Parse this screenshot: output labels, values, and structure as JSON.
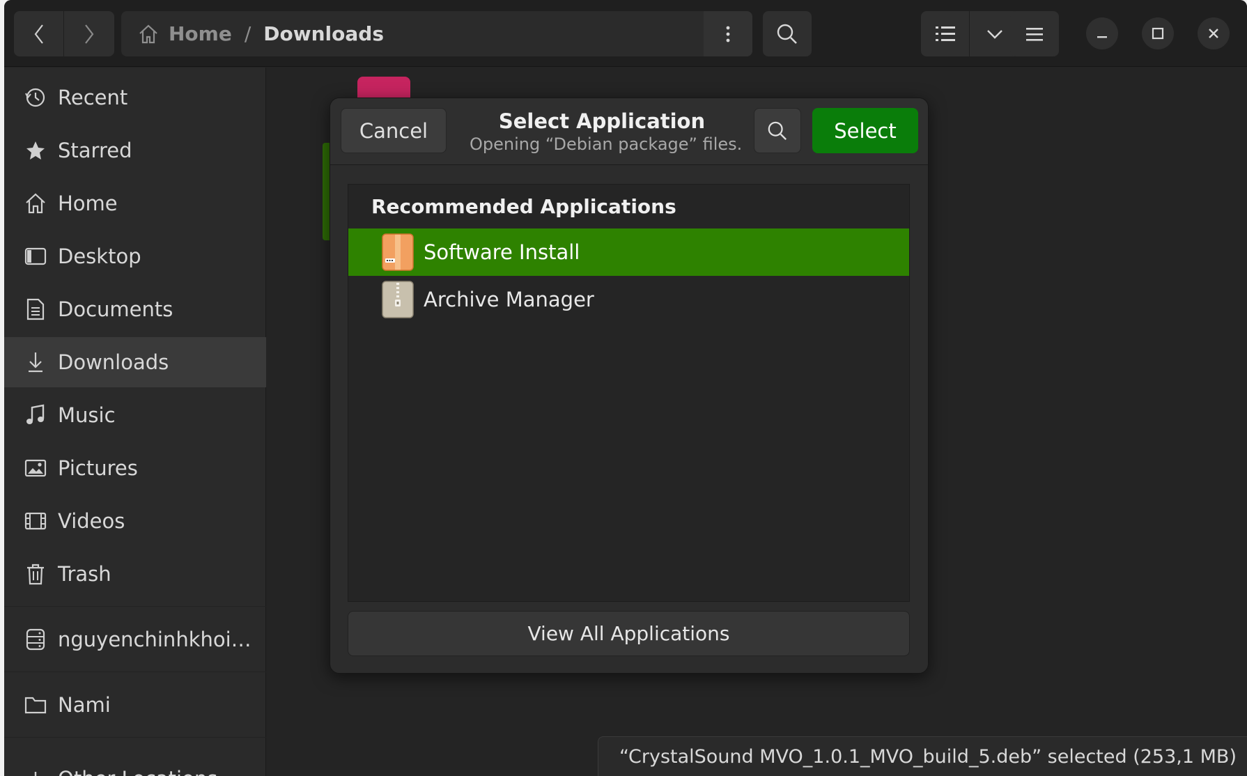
{
  "header": {
    "path": {
      "home": "Home",
      "separator": "/",
      "current": "Downloads"
    }
  },
  "sidebar": {
    "items": [
      {
        "label": "Recent",
        "icon": "clock-icon"
      },
      {
        "label": "Starred",
        "icon": "star-icon"
      },
      {
        "label": "Home",
        "icon": "home-icon"
      },
      {
        "label": "Desktop",
        "icon": "desktop-icon"
      },
      {
        "label": "Documents",
        "icon": "document-icon"
      },
      {
        "label": "Downloads",
        "icon": "download-icon",
        "active": true
      },
      {
        "label": "Music",
        "icon": "music-icon"
      },
      {
        "label": "Pictures",
        "icon": "picture-icon"
      },
      {
        "label": "Videos",
        "icon": "video-icon"
      },
      {
        "label": "Trash",
        "icon": "trash-icon"
      },
      {
        "label": "nguyenchinhkhoi…",
        "icon": "drive-icon"
      },
      {
        "label": "Nami",
        "icon": "folder-icon"
      },
      {
        "label": "Other Locations",
        "icon": "plus-icon"
      }
    ]
  },
  "dialog": {
    "cancel_label": "Cancel",
    "title": "Select Application",
    "subtitle": "Opening “Debian package” files.",
    "select_label": "Select",
    "list_heading": "Recommended Applications",
    "apps": [
      {
        "name": "Software Install",
        "icon": "software-install-icon",
        "selected": true
      },
      {
        "name": "Archive Manager",
        "icon": "archive-manager-icon",
        "selected": false
      }
    ],
    "view_all_label": "View All Applications"
  },
  "status": {
    "text": "“CrystalSound MVO_1.0.1_MVO_build_5.deb” selected  (253,1 MB)"
  },
  "colors": {
    "accent_selected": "#2e8200",
    "select_button": "#0a7d0a",
    "window_bg": "#242424"
  }
}
